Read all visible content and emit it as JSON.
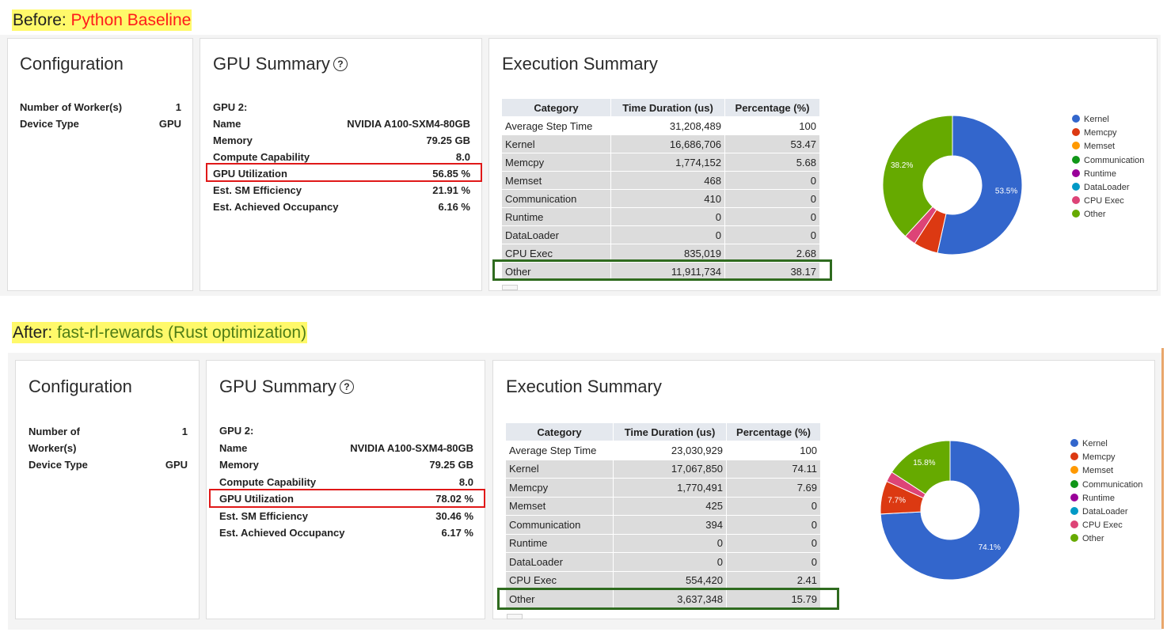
{
  "before": {
    "label_prefix": "Before: ",
    "label_name": "Python Baseline",
    "configuration": {
      "title": "Configuration",
      "rows": [
        {
          "key": "Number of Worker(s)",
          "value": "1"
        },
        {
          "key": "Device Type",
          "value": "GPU"
        }
      ]
    },
    "gpu_summary": {
      "title": "GPU Summary",
      "help_icon": "question-circle-icon",
      "rows": [
        {
          "key": "GPU 2:",
          "value": ""
        },
        {
          "key": "Name",
          "value": "NVIDIA A100-SXM4-80GB"
        },
        {
          "key": "Memory",
          "value": "79.25 GB"
        },
        {
          "key": "Compute Capability",
          "value": "8.0"
        },
        {
          "key": "GPU Utilization",
          "value": "56.85 %"
        },
        {
          "key": "Est. SM Efficiency",
          "value": "21.91 %"
        },
        {
          "key": "Est. Achieved Occupancy",
          "value": "6.16 %"
        }
      ]
    },
    "execution_summary": {
      "title": "Execution Summary",
      "columns": [
        "Category",
        "Time Duration (us)",
        "Percentage (%)"
      ],
      "rows": [
        {
          "category": "Average Step Time",
          "duration": "31,208,489",
          "percentage": "100"
        },
        {
          "category": "Kernel",
          "duration": "16,686,706",
          "percentage": "53.47"
        },
        {
          "category": "Memcpy",
          "duration": "1,774,152",
          "percentage": "5.68"
        },
        {
          "category": "Memset",
          "duration": "468",
          "percentage": "0"
        },
        {
          "category": "Communication",
          "duration": "410",
          "percentage": "0"
        },
        {
          "category": "Runtime",
          "duration": "0",
          "percentage": "0"
        },
        {
          "category": "DataLoader",
          "duration": "0",
          "percentage": "0"
        },
        {
          "category": "CPU Exec",
          "duration": "835,019",
          "percentage": "2.68"
        },
        {
          "category": "Other",
          "duration": "11,911,734",
          "percentage": "38.17"
        }
      ]
    },
    "chart_data": {
      "type": "pie",
      "donut": true,
      "legend_position": "right",
      "labels": [
        "Kernel",
        "Memcpy",
        "Memset",
        "Communication",
        "Runtime",
        "DataLoader",
        "CPU Exec",
        "Other"
      ],
      "values": [
        53.47,
        5.68,
        0,
        0,
        0,
        0,
        2.68,
        38.17
      ],
      "colors": [
        "#3366cc",
        "#dc3912",
        "#ff9900",
        "#109618",
        "#990099",
        "#0099c6",
        "#dd4477",
        "#66aa00"
      ],
      "slice_labels": [
        "53.5%",
        "",
        "",
        "",
        "",
        "",
        "",
        "38.2%"
      ]
    }
  },
  "after": {
    "label_prefix": "After: ",
    "label_name": "fast-rl-rewards (Rust optimization)",
    "configuration": {
      "title": "Configuration",
      "rows": [
        {
          "key": "Number of Worker(s)",
          "value": "1"
        },
        {
          "key": "Device Type",
          "value": "GPU"
        }
      ]
    },
    "gpu_summary": {
      "title": "GPU Summary",
      "help_icon": "question-circle-icon",
      "rows": [
        {
          "key": "GPU 2:",
          "value": ""
        },
        {
          "key": "Name",
          "value": "NVIDIA A100-SXM4-80GB"
        },
        {
          "key": "Memory",
          "value": "79.25 GB"
        },
        {
          "key": "Compute Capability",
          "value": "8.0"
        },
        {
          "key": "GPU Utilization",
          "value": "78.02 %"
        },
        {
          "key": "Est. SM Efficiency",
          "value": "30.46 %"
        },
        {
          "key": "Est. Achieved Occupancy",
          "value": "6.17 %"
        }
      ]
    },
    "execution_summary": {
      "title": "Execution Summary",
      "columns": [
        "Category",
        "Time Duration (us)",
        "Percentage (%)"
      ],
      "rows": [
        {
          "category": "Average Step Time",
          "duration": "23,030,929",
          "percentage": "100"
        },
        {
          "category": "Kernel",
          "duration": "17,067,850",
          "percentage": "74.11"
        },
        {
          "category": "Memcpy",
          "duration": "1,770,491",
          "percentage": "7.69"
        },
        {
          "category": "Memset",
          "duration": "425",
          "percentage": "0"
        },
        {
          "category": "Communication",
          "duration": "394",
          "percentage": "0"
        },
        {
          "category": "Runtime",
          "duration": "0",
          "percentage": "0"
        },
        {
          "category": "DataLoader",
          "duration": "0",
          "percentage": "0"
        },
        {
          "category": "CPU Exec",
          "duration": "554,420",
          "percentage": "2.41"
        },
        {
          "category": "Other",
          "duration": "3,637,348",
          "percentage": "15.79"
        }
      ]
    },
    "chart_data": {
      "type": "pie",
      "donut": true,
      "legend_position": "right",
      "labels": [
        "Kernel",
        "Memcpy",
        "Memset",
        "Communication",
        "Runtime",
        "DataLoader",
        "CPU Exec",
        "Other"
      ],
      "values": [
        74.11,
        7.69,
        0,
        0,
        0,
        0,
        2.41,
        15.79
      ],
      "colors": [
        "#3366cc",
        "#dc3912",
        "#ff9900",
        "#109618",
        "#990099",
        "#0099c6",
        "#dd4477",
        "#66aa00"
      ],
      "slice_labels": [
        "74.1%",
        "7.7%",
        "",
        "",
        "",
        "",
        "",
        "15.8%"
      ]
    }
  }
}
